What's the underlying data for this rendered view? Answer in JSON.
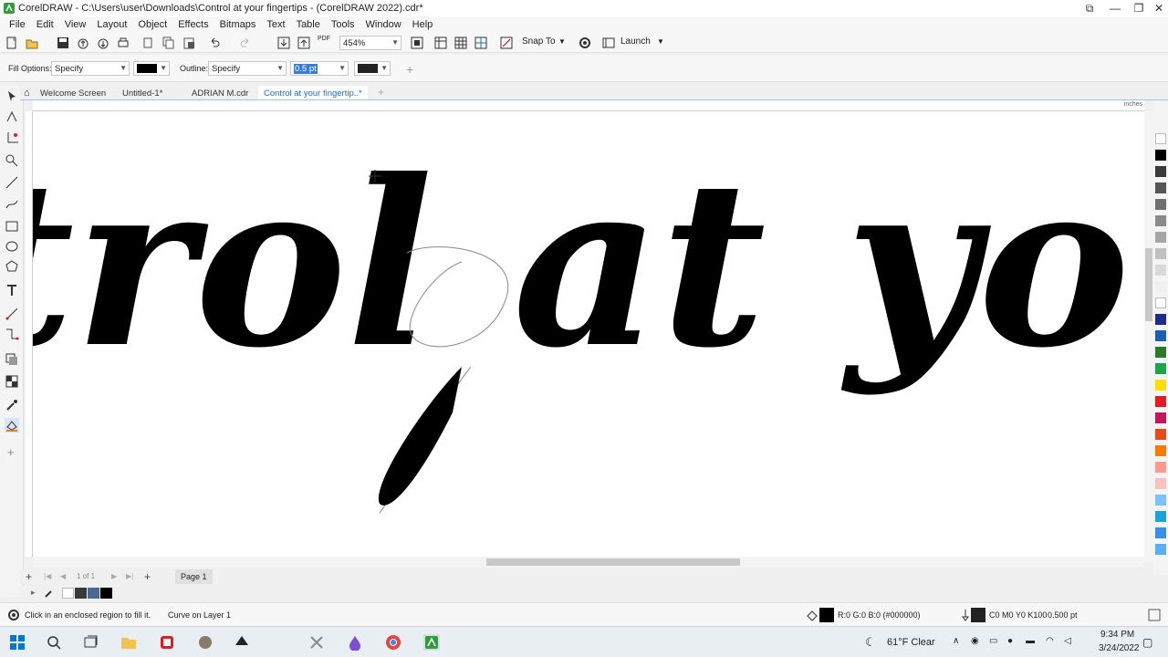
{
  "window": {
    "title": "CorelDRAW - C:\\Users\\user\\Downloads\\Control at your fingertips - (CorelDRAW 2022).cdr*"
  },
  "menu": [
    "File",
    "Edit",
    "View",
    "Layout",
    "Object",
    "Effects",
    "Bitmaps",
    "Text",
    "Table",
    "Tools",
    "Window",
    "Help"
  ],
  "toolbar": {
    "zoom": "454%",
    "snap_to": "Snap To",
    "launch": "Launch",
    "pdf": "PDF"
  },
  "propbar": {
    "fill_label": "Fill Options:",
    "fill_value": "Specify",
    "outline_label": "Outline:",
    "outline_value": "Specify",
    "outline_width": "0.5 pt"
  },
  "tabs": [
    "Welcome Screen",
    "Untitled-1*",
    "ADRIAN M.cdr",
    "Control at your fingertip..*"
  ],
  "ruler": {
    "units": "inches"
  },
  "canvas": {
    "text": "trol at your finge"
  },
  "pagebar": {
    "page_count": "1 of 1",
    "page_tab": "Page 1"
  },
  "status": {
    "hint": "Click in an enclosed region to fill it.",
    "selection": "Curve on Layer 1",
    "fill_color": "R:0 G:0 B:0 (#000000)",
    "outline_color": "C0 M0 Y0 K100",
    "outline_width": "0.500 pt"
  },
  "taskbar": {
    "weather": "61°F  Clear",
    "time": "9:34 PM",
    "date": "3/24/2022"
  },
  "colors": {
    "accent": "#1c6fc4",
    "canvas_bg": "#ffffff",
    "glyph": "#000000"
  },
  "palette": [
    "#ffffff",
    "#000000",
    "#3a3a3a",
    "#555555",
    "#707070",
    "#8a8a8a",
    "#a5a5a5",
    "#c0c0c0",
    "#dadada",
    "#f0f0f0",
    "#ffffff",
    "#1f2b8c",
    "#1a5fb4",
    "#2a7a2a",
    "#1fa34a",
    "#ffde00",
    "#e01b24",
    "#c2185b",
    "#e64a19",
    "#f57c00",
    "#ff9a8a",
    "#f9c0c0",
    "#7fc0ff",
    "#1aa3d9",
    "#3a8ee6",
    "#58b0f0"
  ]
}
